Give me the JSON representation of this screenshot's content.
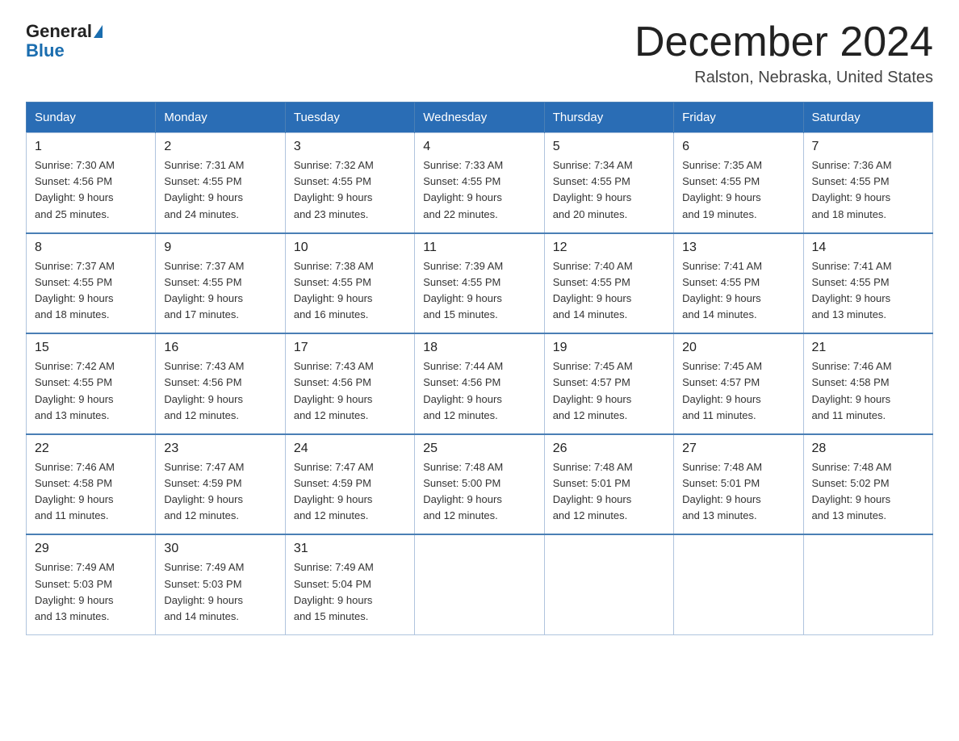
{
  "header": {
    "logo_general": "General",
    "logo_blue": "Blue",
    "month_title": "December 2024",
    "subtitle": "Ralston, Nebraska, United States"
  },
  "days_of_week": [
    "Sunday",
    "Monday",
    "Tuesday",
    "Wednesday",
    "Thursday",
    "Friday",
    "Saturday"
  ],
  "weeks": [
    [
      {
        "day": "1",
        "info": "Sunrise: 7:30 AM\nSunset: 4:56 PM\nDaylight: 9 hours\nand 25 minutes."
      },
      {
        "day": "2",
        "info": "Sunrise: 7:31 AM\nSunset: 4:55 PM\nDaylight: 9 hours\nand 24 minutes."
      },
      {
        "day": "3",
        "info": "Sunrise: 7:32 AM\nSunset: 4:55 PM\nDaylight: 9 hours\nand 23 minutes."
      },
      {
        "day": "4",
        "info": "Sunrise: 7:33 AM\nSunset: 4:55 PM\nDaylight: 9 hours\nand 22 minutes."
      },
      {
        "day": "5",
        "info": "Sunrise: 7:34 AM\nSunset: 4:55 PM\nDaylight: 9 hours\nand 20 minutes."
      },
      {
        "day": "6",
        "info": "Sunrise: 7:35 AM\nSunset: 4:55 PM\nDaylight: 9 hours\nand 19 minutes."
      },
      {
        "day": "7",
        "info": "Sunrise: 7:36 AM\nSunset: 4:55 PM\nDaylight: 9 hours\nand 18 minutes."
      }
    ],
    [
      {
        "day": "8",
        "info": "Sunrise: 7:37 AM\nSunset: 4:55 PM\nDaylight: 9 hours\nand 18 minutes."
      },
      {
        "day": "9",
        "info": "Sunrise: 7:37 AM\nSunset: 4:55 PM\nDaylight: 9 hours\nand 17 minutes."
      },
      {
        "day": "10",
        "info": "Sunrise: 7:38 AM\nSunset: 4:55 PM\nDaylight: 9 hours\nand 16 minutes."
      },
      {
        "day": "11",
        "info": "Sunrise: 7:39 AM\nSunset: 4:55 PM\nDaylight: 9 hours\nand 15 minutes."
      },
      {
        "day": "12",
        "info": "Sunrise: 7:40 AM\nSunset: 4:55 PM\nDaylight: 9 hours\nand 14 minutes."
      },
      {
        "day": "13",
        "info": "Sunrise: 7:41 AM\nSunset: 4:55 PM\nDaylight: 9 hours\nand 14 minutes."
      },
      {
        "day": "14",
        "info": "Sunrise: 7:41 AM\nSunset: 4:55 PM\nDaylight: 9 hours\nand 13 minutes."
      }
    ],
    [
      {
        "day": "15",
        "info": "Sunrise: 7:42 AM\nSunset: 4:55 PM\nDaylight: 9 hours\nand 13 minutes."
      },
      {
        "day": "16",
        "info": "Sunrise: 7:43 AM\nSunset: 4:56 PM\nDaylight: 9 hours\nand 12 minutes."
      },
      {
        "day": "17",
        "info": "Sunrise: 7:43 AM\nSunset: 4:56 PM\nDaylight: 9 hours\nand 12 minutes."
      },
      {
        "day": "18",
        "info": "Sunrise: 7:44 AM\nSunset: 4:56 PM\nDaylight: 9 hours\nand 12 minutes."
      },
      {
        "day": "19",
        "info": "Sunrise: 7:45 AM\nSunset: 4:57 PM\nDaylight: 9 hours\nand 12 minutes."
      },
      {
        "day": "20",
        "info": "Sunrise: 7:45 AM\nSunset: 4:57 PM\nDaylight: 9 hours\nand 11 minutes."
      },
      {
        "day": "21",
        "info": "Sunrise: 7:46 AM\nSunset: 4:58 PM\nDaylight: 9 hours\nand 11 minutes."
      }
    ],
    [
      {
        "day": "22",
        "info": "Sunrise: 7:46 AM\nSunset: 4:58 PM\nDaylight: 9 hours\nand 11 minutes."
      },
      {
        "day": "23",
        "info": "Sunrise: 7:47 AM\nSunset: 4:59 PM\nDaylight: 9 hours\nand 12 minutes."
      },
      {
        "day": "24",
        "info": "Sunrise: 7:47 AM\nSunset: 4:59 PM\nDaylight: 9 hours\nand 12 minutes."
      },
      {
        "day": "25",
        "info": "Sunrise: 7:48 AM\nSunset: 5:00 PM\nDaylight: 9 hours\nand 12 minutes."
      },
      {
        "day": "26",
        "info": "Sunrise: 7:48 AM\nSunset: 5:01 PM\nDaylight: 9 hours\nand 12 minutes."
      },
      {
        "day": "27",
        "info": "Sunrise: 7:48 AM\nSunset: 5:01 PM\nDaylight: 9 hours\nand 13 minutes."
      },
      {
        "day": "28",
        "info": "Sunrise: 7:48 AM\nSunset: 5:02 PM\nDaylight: 9 hours\nand 13 minutes."
      }
    ],
    [
      {
        "day": "29",
        "info": "Sunrise: 7:49 AM\nSunset: 5:03 PM\nDaylight: 9 hours\nand 13 minutes."
      },
      {
        "day": "30",
        "info": "Sunrise: 7:49 AM\nSunset: 5:03 PM\nDaylight: 9 hours\nand 14 minutes."
      },
      {
        "day": "31",
        "info": "Sunrise: 7:49 AM\nSunset: 5:04 PM\nDaylight: 9 hours\nand 15 minutes."
      },
      {
        "day": "",
        "info": ""
      },
      {
        "day": "",
        "info": ""
      },
      {
        "day": "",
        "info": ""
      },
      {
        "day": "",
        "info": ""
      }
    ]
  ]
}
